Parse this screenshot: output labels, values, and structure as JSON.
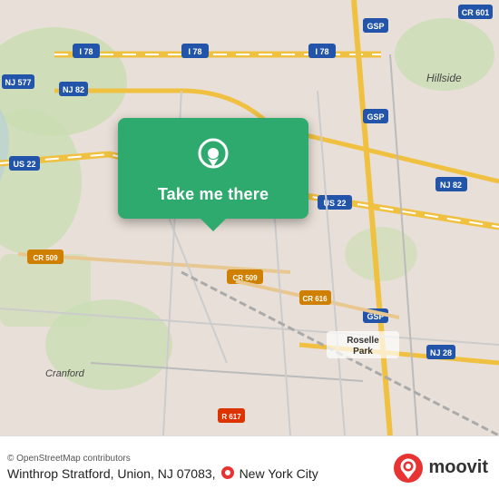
{
  "map": {
    "alt": "Map of Union, NJ area"
  },
  "card": {
    "label": "Take me there"
  },
  "bottom_bar": {
    "attribution": "© OpenStreetMap contributors",
    "location": "Winthrop Stratford, Union, NJ 07083,",
    "city": "New York City",
    "moovit_text": "moovit"
  },
  "icons": {
    "pin": "location-pin-icon",
    "moovit": "moovit-logo-icon"
  }
}
